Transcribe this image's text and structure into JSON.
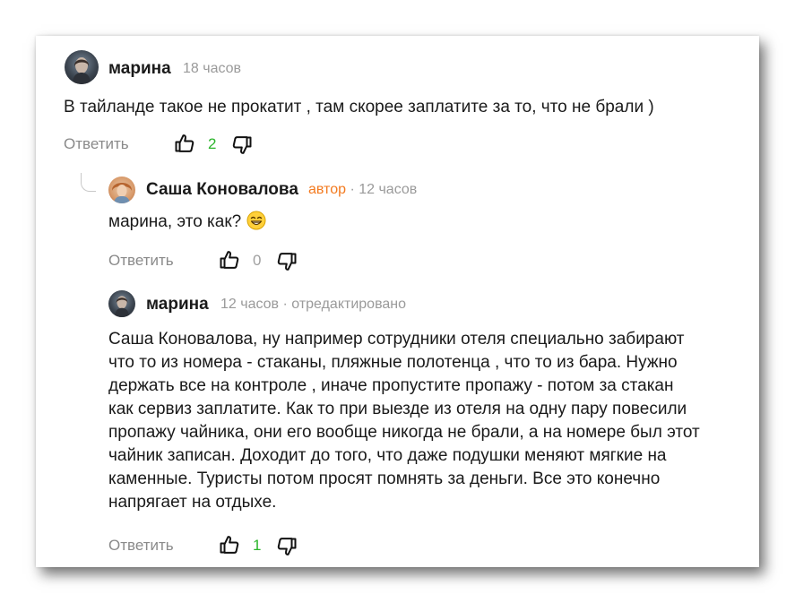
{
  "comments": [
    {
      "author": "марина",
      "time": "18 часов",
      "text": "В тайланде такое не прокатит , там скорее заплатите за то, что не брали )",
      "reply_label": "Ответить",
      "likes": "2"
    },
    {
      "author": "Саша Коновалова",
      "badge": "автор",
      "meta": " · 12 часов",
      "text": "марина, это как?",
      "reply_label": "Ответить",
      "likes": "0"
    },
    {
      "author": "марина",
      "meta": "12 часов · отредактировано",
      "lines": [
        "Саша Коновалова, ну например сотрудники отеля специально забирают",
        "что то из номера - стаканы, пляжные полотенца , что то из бара. Нужно",
        "держать все на контроле , иначе пропустите пропажу - потом за стакан",
        "как сервиз заплатите. Как то при выезде из отеля на одну пару повесили",
        "пропажу чайника, они его вообще никогда не брали, а на номере был этот",
        "чайник записан. Доходит до того, что даже подушки меняют мягкие на",
        "каменные. Туристы потом просят помнять за деньги. Все это конечно",
        "напрягает на отдыхе."
      ],
      "reply_label": "Ответить",
      "likes": "1"
    }
  ],
  "colors": {
    "positive": "#2bb52b",
    "author_badge": "#f37a1f",
    "meta": "#9a9a9a"
  },
  "icons": [
    "thumbs-up-icon",
    "thumbs-down-icon",
    "grinning-emoji-icon"
  ]
}
